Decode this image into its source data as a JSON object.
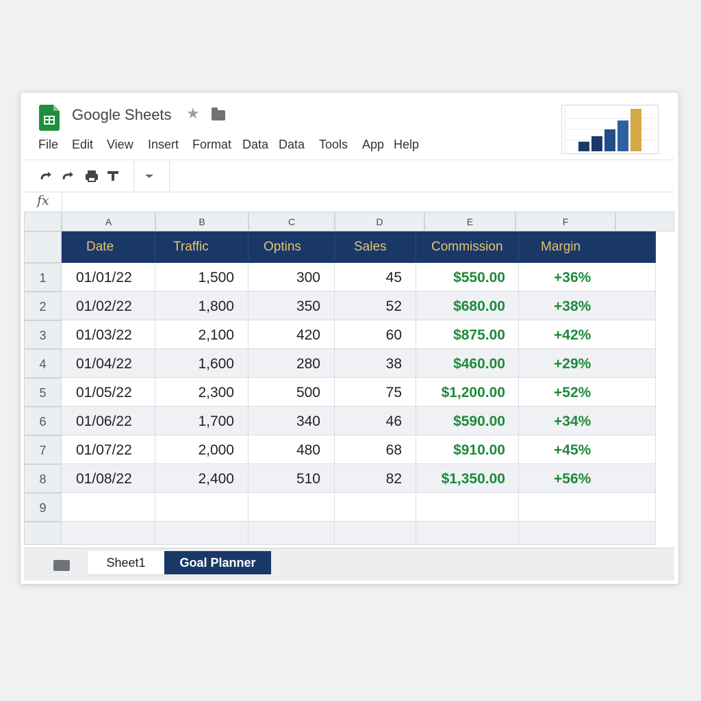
{
  "app": {
    "title": "Google Sheets",
    "brand_color": "#1e8e3e"
  },
  "menu": {
    "items": [
      "File",
      "Edit",
      "View",
      "Insert",
      "Format",
      "Data",
      "Data",
      "Tools",
      "App",
      "Help"
    ]
  },
  "toolbar": {
    "icons": [
      "redo-icon",
      "redo-icon",
      "print-icon",
      "text-format-icon",
      "dropdown-arrow-icon"
    ]
  },
  "formula_bar": {
    "label": "fx",
    "value": ""
  },
  "columns": {
    "letters": [
      "A",
      "B",
      "C",
      "D",
      "E",
      "F"
    ]
  },
  "table": {
    "headers": [
      "Date",
      "Traffic",
      "Optins",
      "Sales",
      "Commission",
      "Margin"
    ],
    "header_bg": "#193868",
    "header_text_color": "#e9c46a",
    "positive_color": "#1e8a3a",
    "rows": [
      {
        "num": "1",
        "date": "01/01/22",
        "traffic": "1,500",
        "optins": "300",
        "sales": "45",
        "commission": "$550.00",
        "margin": "+36%"
      },
      {
        "num": "2",
        "date": "01/02/22",
        "traffic": "1,800",
        "optins": "350",
        "sales": "52",
        "commission": "$680.00",
        "margin": "+38%"
      },
      {
        "num": "3",
        "date": "01/03/22",
        "traffic": "2,100",
        "optins": "420",
        "sales": "60",
        "commission": "$875.00",
        "margin": "+42%"
      },
      {
        "num": "4",
        "date": "01/04/22",
        "traffic": "1,600",
        "optins": "280",
        "sales": "38",
        "commission": "$460.00",
        "margin": "+29%"
      },
      {
        "num": "5",
        "date": "01/05/22",
        "traffic": "2,300",
        "optins": "500",
        "sales": "75",
        "commission": "$1,200.00",
        "margin": "+52%"
      },
      {
        "num": "6",
        "date": "01/06/22",
        "traffic": "1,700",
        "optins": "340",
        "sales": "46",
        "commission": "$590.00",
        "margin": "+34%"
      },
      {
        "num": "7",
        "date": "01/07/22",
        "traffic": "2,000",
        "optins": "480",
        "sales": "68",
        "commission": "$910.00",
        "margin": "+45%"
      },
      {
        "num": "8",
        "date": "01/08/22",
        "traffic": "2,400",
        "optins": "510",
        "sales": "82",
        "commission": "$1,350.00",
        "margin": "+56%"
      }
    ],
    "empty_row_num": "9"
  },
  "sheet_tabs": {
    "tabs": [
      "Sheet1",
      "Goal Planner"
    ],
    "active": "Goal Planner"
  },
  "mini_chart": {
    "bar_colors": [
      "#1b3a6b",
      "#1b3a6b",
      "#234b86",
      "#2e5f9e",
      "#d4a843"
    ]
  }
}
